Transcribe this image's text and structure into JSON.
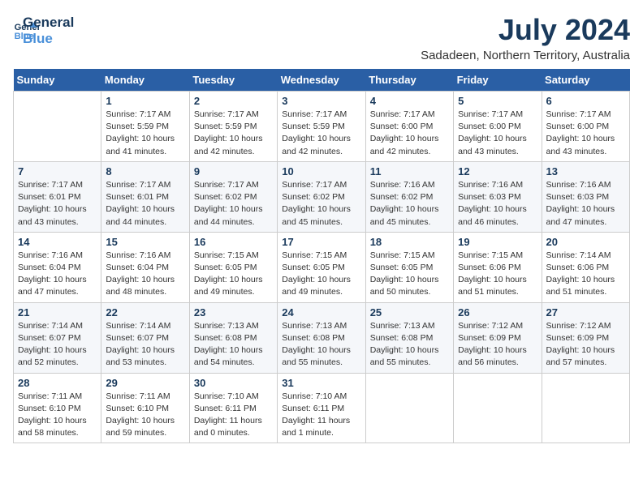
{
  "header": {
    "logo_line1": "General",
    "logo_line2": "Blue",
    "month_year": "July 2024",
    "location": "Sadadeen, Northern Territory, Australia"
  },
  "days_of_week": [
    "Sunday",
    "Monday",
    "Tuesday",
    "Wednesday",
    "Thursday",
    "Friday",
    "Saturday"
  ],
  "weeks": [
    [
      {
        "day": "",
        "sunrise": "",
        "sunset": "",
        "daylight": ""
      },
      {
        "day": "1",
        "sunrise": "Sunrise: 7:17 AM",
        "sunset": "Sunset: 5:59 PM",
        "daylight": "Daylight: 10 hours and 41 minutes."
      },
      {
        "day": "2",
        "sunrise": "Sunrise: 7:17 AM",
        "sunset": "Sunset: 5:59 PM",
        "daylight": "Daylight: 10 hours and 42 minutes."
      },
      {
        "day": "3",
        "sunrise": "Sunrise: 7:17 AM",
        "sunset": "Sunset: 5:59 PM",
        "daylight": "Daylight: 10 hours and 42 minutes."
      },
      {
        "day": "4",
        "sunrise": "Sunrise: 7:17 AM",
        "sunset": "Sunset: 6:00 PM",
        "daylight": "Daylight: 10 hours and 42 minutes."
      },
      {
        "day": "5",
        "sunrise": "Sunrise: 7:17 AM",
        "sunset": "Sunset: 6:00 PM",
        "daylight": "Daylight: 10 hours and 43 minutes."
      },
      {
        "day": "6",
        "sunrise": "Sunrise: 7:17 AM",
        "sunset": "Sunset: 6:00 PM",
        "daylight": "Daylight: 10 hours and 43 minutes."
      }
    ],
    [
      {
        "day": "7",
        "sunrise": "Sunrise: 7:17 AM",
        "sunset": "Sunset: 6:01 PM",
        "daylight": "Daylight: 10 hours and 43 minutes."
      },
      {
        "day": "8",
        "sunrise": "Sunrise: 7:17 AM",
        "sunset": "Sunset: 6:01 PM",
        "daylight": "Daylight: 10 hours and 44 minutes."
      },
      {
        "day": "9",
        "sunrise": "Sunrise: 7:17 AM",
        "sunset": "Sunset: 6:02 PM",
        "daylight": "Daylight: 10 hours and 44 minutes."
      },
      {
        "day": "10",
        "sunrise": "Sunrise: 7:17 AM",
        "sunset": "Sunset: 6:02 PM",
        "daylight": "Daylight: 10 hours and 45 minutes."
      },
      {
        "day": "11",
        "sunrise": "Sunrise: 7:16 AM",
        "sunset": "Sunset: 6:02 PM",
        "daylight": "Daylight: 10 hours and 45 minutes."
      },
      {
        "day": "12",
        "sunrise": "Sunrise: 7:16 AM",
        "sunset": "Sunset: 6:03 PM",
        "daylight": "Daylight: 10 hours and 46 minutes."
      },
      {
        "day": "13",
        "sunrise": "Sunrise: 7:16 AM",
        "sunset": "Sunset: 6:03 PM",
        "daylight": "Daylight: 10 hours and 47 minutes."
      }
    ],
    [
      {
        "day": "14",
        "sunrise": "Sunrise: 7:16 AM",
        "sunset": "Sunset: 6:04 PM",
        "daylight": "Daylight: 10 hours and 47 minutes."
      },
      {
        "day": "15",
        "sunrise": "Sunrise: 7:16 AM",
        "sunset": "Sunset: 6:04 PM",
        "daylight": "Daylight: 10 hours and 48 minutes."
      },
      {
        "day": "16",
        "sunrise": "Sunrise: 7:15 AM",
        "sunset": "Sunset: 6:05 PM",
        "daylight": "Daylight: 10 hours and 49 minutes."
      },
      {
        "day": "17",
        "sunrise": "Sunrise: 7:15 AM",
        "sunset": "Sunset: 6:05 PM",
        "daylight": "Daylight: 10 hours and 49 minutes."
      },
      {
        "day": "18",
        "sunrise": "Sunrise: 7:15 AM",
        "sunset": "Sunset: 6:05 PM",
        "daylight": "Daylight: 10 hours and 50 minutes."
      },
      {
        "day": "19",
        "sunrise": "Sunrise: 7:15 AM",
        "sunset": "Sunset: 6:06 PM",
        "daylight": "Daylight: 10 hours and 51 minutes."
      },
      {
        "day": "20",
        "sunrise": "Sunrise: 7:14 AM",
        "sunset": "Sunset: 6:06 PM",
        "daylight": "Daylight: 10 hours and 51 minutes."
      }
    ],
    [
      {
        "day": "21",
        "sunrise": "Sunrise: 7:14 AM",
        "sunset": "Sunset: 6:07 PM",
        "daylight": "Daylight: 10 hours and 52 minutes."
      },
      {
        "day": "22",
        "sunrise": "Sunrise: 7:14 AM",
        "sunset": "Sunset: 6:07 PM",
        "daylight": "Daylight: 10 hours and 53 minutes."
      },
      {
        "day": "23",
        "sunrise": "Sunrise: 7:13 AM",
        "sunset": "Sunset: 6:08 PM",
        "daylight": "Daylight: 10 hours and 54 minutes."
      },
      {
        "day": "24",
        "sunrise": "Sunrise: 7:13 AM",
        "sunset": "Sunset: 6:08 PM",
        "daylight": "Daylight: 10 hours and 55 minutes."
      },
      {
        "day": "25",
        "sunrise": "Sunrise: 7:13 AM",
        "sunset": "Sunset: 6:08 PM",
        "daylight": "Daylight: 10 hours and 55 minutes."
      },
      {
        "day": "26",
        "sunrise": "Sunrise: 7:12 AM",
        "sunset": "Sunset: 6:09 PM",
        "daylight": "Daylight: 10 hours and 56 minutes."
      },
      {
        "day": "27",
        "sunrise": "Sunrise: 7:12 AM",
        "sunset": "Sunset: 6:09 PM",
        "daylight": "Daylight: 10 hours and 57 minutes."
      }
    ],
    [
      {
        "day": "28",
        "sunrise": "Sunrise: 7:11 AM",
        "sunset": "Sunset: 6:10 PM",
        "daylight": "Daylight: 10 hours and 58 minutes."
      },
      {
        "day": "29",
        "sunrise": "Sunrise: 7:11 AM",
        "sunset": "Sunset: 6:10 PM",
        "daylight": "Daylight: 10 hours and 59 minutes."
      },
      {
        "day": "30",
        "sunrise": "Sunrise: 7:10 AM",
        "sunset": "Sunset: 6:11 PM",
        "daylight": "Daylight: 11 hours and 0 minutes."
      },
      {
        "day": "31",
        "sunrise": "Sunrise: 7:10 AM",
        "sunset": "Sunset: 6:11 PM",
        "daylight": "Daylight: 11 hours and 1 minute."
      },
      {
        "day": "",
        "sunrise": "",
        "sunset": "",
        "daylight": ""
      },
      {
        "day": "",
        "sunrise": "",
        "sunset": "",
        "daylight": ""
      },
      {
        "day": "",
        "sunrise": "",
        "sunset": "",
        "daylight": ""
      }
    ]
  ]
}
